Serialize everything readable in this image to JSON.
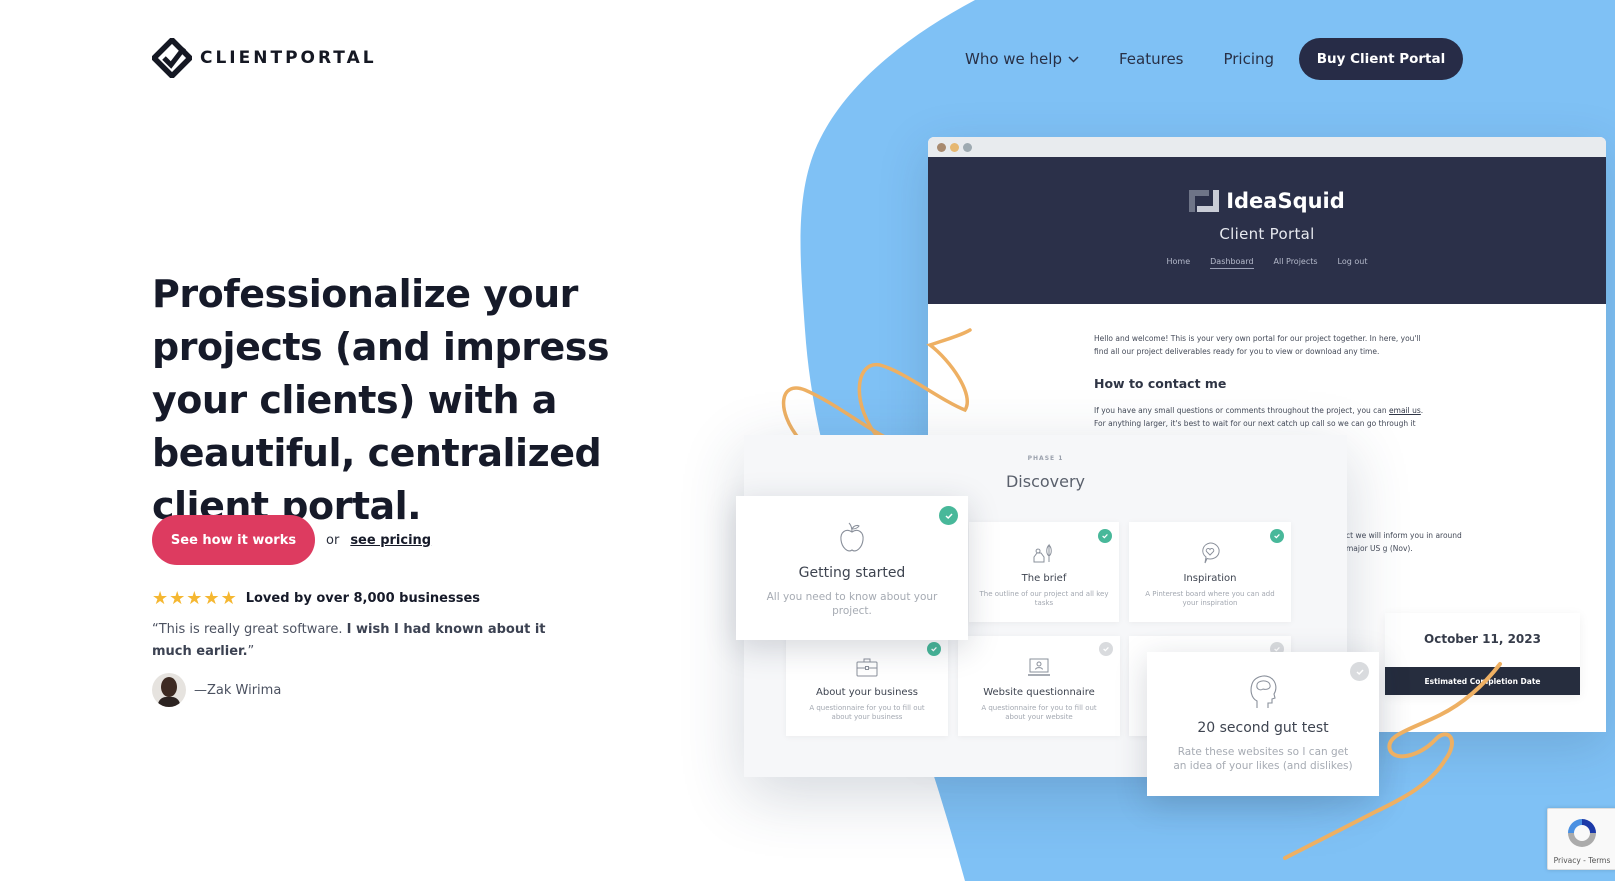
{
  "brand": {
    "name": "CLIENTPORTAL",
    "logo_icon": "diamond-check-icon"
  },
  "nav": {
    "items": [
      {
        "label": "Who we help",
        "has_dropdown": true
      },
      {
        "label": "Features"
      },
      {
        "label": "Pricing"
      }
    ],
    "cta_label": "Buy Client Portal"
  },
  "hero": {
    "title": "Professionalize your projects (and impress your clients) with a beautiful, centralized client portal.",
    "primary_cta": "See how it works",
    "or_text": "or",
    "secondary_cta": "see pricing",
    "rating": {
      "stars": 5,
      "max_stars": 5,
      "text": "Loved by over 8,000 businesses"
    },
    "quote": {
      "plain": "“This is really great software. ",
      "bold": "I wish I had known about it much earlier.",
      "close": "”"
    },
    "author": "—Zak Wirima"
  },
  "mockup": {
    "window_dots": [
      "#a88a6f",
      "#e6b872",
      "#9eaab1"
    ],
    "portal": {
      "brand": "IdeaSquid",
      "subtitle": "Client Portal",
      "nav": [
        "Home",
        "Dashboard",
        "All Projects",
        "Log out"
      ],
      "active_nav": "Dashboard",
      "welcome": "Hello and welcome! This is your very own portal for our project together. In here, you'll find all our project deliverables ready for you to view or download any time.",
      "contact_heading": "How to contact me",
      "contact_text": "If you have any small questions or comments throughout the project, you can ",
      "contact_link": "email us",
      "contact_text_2": ". For anything larger, it's best to wait for our next catch up call so we can go through it",
      "partial_text": "ct we will inform you in around major US g (Nov).",
      "completion_date": "October 11, 2023",
      "completion_label": "Estimated Completion Date"
    },
    "phase": {
      "label": "PHASE 1",
      "title": "Discovery",
      "tasks": [
        {
          "title": "Getting started",
          "desc": "All you need to know about your project.",
          "icon": "apple-icon",
          "done": true
        },
        {
          "title": "The brief",
          "desc": "The outline of our project and all key tasks",
          "icon": "brief-icon",
          "done": true
        },
        {
          "title": "Inspiration",
          "desc": "A Pinterest board where you can add your inspiration",
          "icon": "heart-bubble-icon",
          "done": true
        },
        {
          "title": "About your business",
          "desc": "A questionnaire for you to fill out about your business",
          "icon": "briefcase-icon",
          "done": true
        },
        {
          "title": "Website questionnaire",
          "desc": "A questionnaire for you to fill out about your website",
          "icon": "laptop-icon",
          "done": false
        },
        {
          "title": "20 second gut test",
          "desc": "Rate these websites so I can get an idea of your likes (and dislikes)",
          "icon": "brain-head-icon",
          "done": false
        }
      ]
    }
  },
  "recaptcha": {
    "links": "Privacy - Terms"
  },
  "colors": {
    "blob": "#7fc1f5",
    "navy": "#272c47",
    "cta_pink": "#dd3b60",
    "star": "#f5b731",
    "check_green": "#48b89a",
    "squiggle": "#eeb063"
  }
}
